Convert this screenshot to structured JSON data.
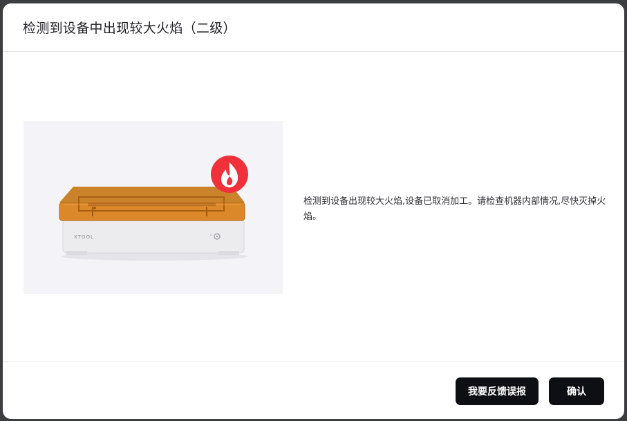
{
  "dialog": {
    "title": "检测到设备中出现较大火焰（二级）",
    "message": "检测到设备出现较大火焰,设备已取消加工。请检查机器内部情况,尽快灭掉火焰。",
    "illustration": {
      "brand_text": "XTOOL",
      "alert_icon": "fire-icon",
      "alert_color": "#f0303a",
      "lid_color": "#d9821f",
      "body_color": "#e9e9ec"
    },
    "footer": {
      "report_label": "我要反馈误报",
      "confirm_label": "确认"
    }
  }
}
